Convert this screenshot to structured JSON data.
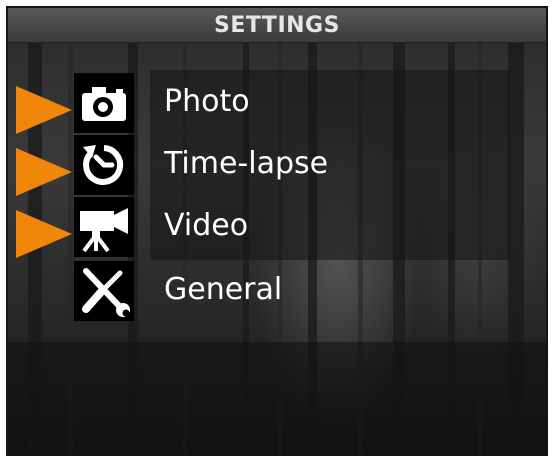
{
  "header": {
    "title": "SETTINGS"
  },
  "menu": {
    "items": [
      {
        "label": "Photo",
        "icon": "camera-icon",
        "selected": true
      },
      {
        "label": "Time-lapse",
        "icon": "timelapse-icon",
        "selected": true
      },
      {
        "label": "Video",
        "icon": "video-camera-icon",
        "selected": true
      },
      {
        "label": "General",
        "icon": "wrench-screwdriver-icon",
        "selected": false
      }
    ]
  },
  "colors": {
    "accent": "#f0860a",
    "header_bg": "#4a4a4a",
    "text": "#ffffff",
    "icon_bg": "#000000"
  }
}
